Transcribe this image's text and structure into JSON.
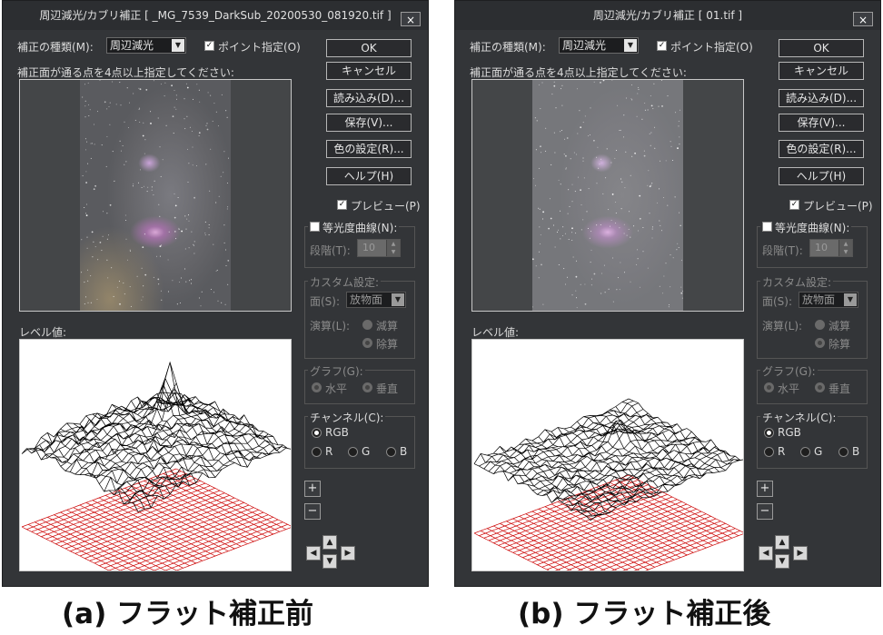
{
  "common": {
    "close_label": "×",
    "type_label": "補正の種類(M):",
    "type_value": "周辺減光",
    "point_label": "ポイント指定(O)",
    "instruction": "補正面が通る点を4点以上指定してください:",
    "buttons": [
      "OK",
      "キャンセル",
      "読み込み(D)...",
      "保存(V)...",
      "色の設定(R)...",
      "ヘルプ(H)"
    ],
    "preview_label": "プレビュー(P)",
    "iso_label": "等光度曲線(N):",
    "step_label": "段階(T):",
    "step_value": "10",
    "custom_title": "カスタム設定:",
    "surface_label": "面(S):",
    "surface_value": "放物面",
    "op_label": "演算(L):",
    "op_sub": "減算",
    "op_div": "除算",
    "graph_title": "グラフ(G):",
    "graph_h": "水平",
    "graph_v": "垂直",
    "channel_title": "チャンネル(C):",
    "ch_rgb": "RGB",
    "ch_r": "R",
    "ch_g": "G",
    "ch_b": "B",
    "level_label": "レベル値:",
    "plus": "+",
    "minus": "−",
    "arrow_left": "◀",
    "arrow_right": "▶",
    "arrow_up": "▲",
    "arrow_down": "▼"
  },
  "panels": [
    {
      "title": "周辺減光/カブリ補正 [ _MG_7539_DarkSub_20200530_081920.tif ]",
      "caption": "(a) フラット補正前"
    },
    {
      "title": "周辺減光/カブリ補正 [ 01.tif ]",
      "caption": "(b) フラット補正後"
    }
  ],
  "colors": {
    "window_bg": "#333538",
    "mesh_black": "#000000",
    "mesh_red": "#cc0000"
  }
}
